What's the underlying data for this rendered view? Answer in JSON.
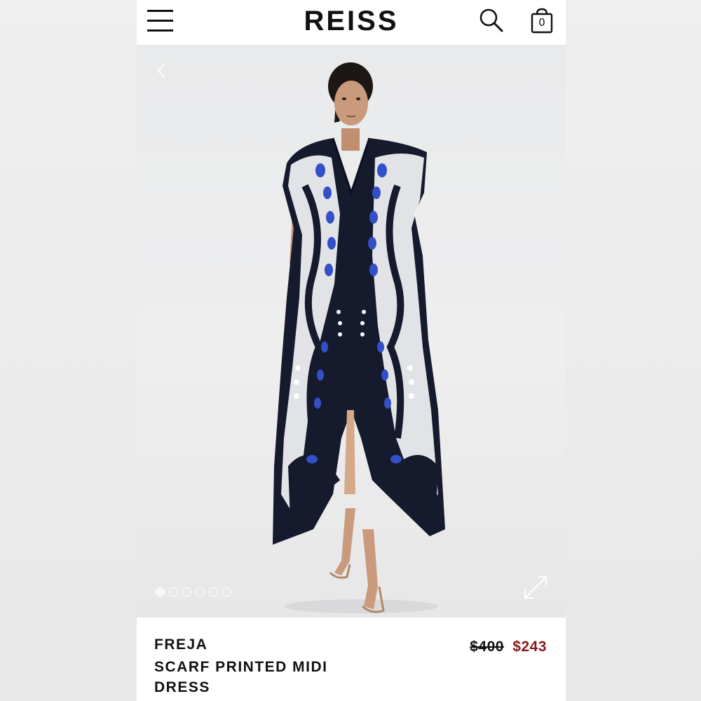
{
  "header": {
    "logo": "REISS",
    "menu_icon": "hamburger-menu-icon",
    "search_icon": "search-icon",
    "bag_icon": "shopping-bag-icon",
    "bag_count": "0"
  },
  "gallery": {
    "prev_icon": "chevron-left-icon",
    "expand_icon": "expand-icon",
    "image_count": 6,
    "active_index": 0,
    "dress_colors": {
      "navy": "#151a2c",
      "blue": "#3450c8",
      "white": "#f4f4f6"
    }
  },
  "product": {
    "brand": "FREJA",
    "name": "SCARF PRINTED MIDI DRESS",
    "original_price": "$400",
    "sale_price": "$243",
    "sale_color": "#8b1a1a"
  }
}
